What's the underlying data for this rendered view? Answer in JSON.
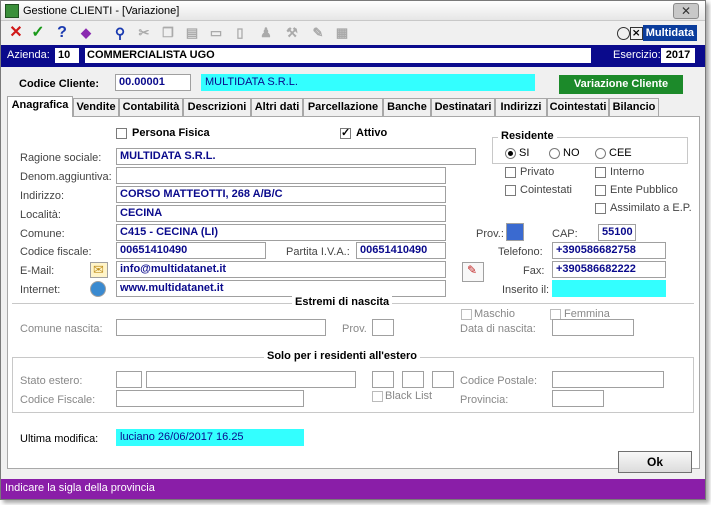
{
  "window": {
    "title": "Gestione CLIENTI - [Variazione]",
    "close": "✕"
  },
  "logo": {
    "label": "Multidata"
  },
  "azienda": {
    "label": "Azienda:",
    "code": "10",
    "name": "COMMERCIALISTA UGO",
    "esercizio_label": "Esercizio:",
    "esercizio": "2017"
  },
  "cliente": {
    "label": "Codice Cliente:",
    "code": "00.00001",
    "name": "MULTIDATA S.R.L.",
    "mode_button": "Variazione Cliente"
  },
  "tabs": [
    "Anagrafica",
    "Vendite",
    "Contabilità",
    "Descrizioni",
    "Altri dati",
    "Parcellazione",
    "Banche",
    "Destinatari",
    "Indirizzi",
    "Cointestati",
    "Bilancio"
  ],
  "form": {
    "persona_fisica": "Persona Fisica",
    "attivo": "Attivo",
    "ragione_sociale_label": "Ragione sociale:",
    "ragione_sociale": "MULTIDATA S.R.L.",
    "denom_label": "Denom.aggiuntiva:",
    "denom": "",
    "indirizzo_label": "Indirizzo:",
    "indirizzo": "CORSO MATTEOTTI, 268 A/B/C",
    "localita_label": "Località:",
    "localita": "CECINA",
    "comune_label": "Comune:",
    "comune": "C415 - CECINA (LI)",
    "prov_label": "Prov.:",
    "cap_label": "CAP:",
    "cap": "55100",
    "cf_label": "Codice fiscale:",
    "cf": "00651410490",
    "piva_label": "Partita I.V.A.:",
    "piva": "00651410490",
    "tel_label": "Telefono:",
    "tel": "+390586682758",
    "email_label": "E-Mail:",
    "email": "info@multidatanet.it",
    "fax_label": "Fax:",
    "fax": "+390586682222",
    "internet_label": "Internet:",
    "internet": "www.multidatanet.it",
    "inserito_label": "Inserito il:",
    "inserito": ""
  },
  "residente": {
    "title": "Residente",
    "options": [
      "SI",
      "NO",
      "CEE"
    ],
    "privato": "Privato",
    "interno": "Interno",
    "cointestati": "Cointestati",
    "ente": "Ente Pubblico",
    "assimilato": "Assimilato a E.P."
  },
  "nascita": {
    "title": "Estremi di nascita",
    "comune_label": "Comune nascita:",
    "prov_label": "Prov.",
    "maschio": "Maschio",
    "femmina": "Femmina",
    "data_label": "Data di nascita:"
  },
  "estero": {
    "title": "Solo per i residenti all'estero",
    "stato_label": "Stato estero:",
    "cf_label": "Codice Fiscale:",
    "black_list": "Black List",
    "cap_label": "Codice Postale:",
    "prov_label": "Provincia:"
  },
  "ultima": {
    "label": "Ultima modifica:",
    "value": "luciano 26/06/2017 16.25"
  },
  "ok": "Ok",
  "status": "Indicare la sigla della provincia"
}
